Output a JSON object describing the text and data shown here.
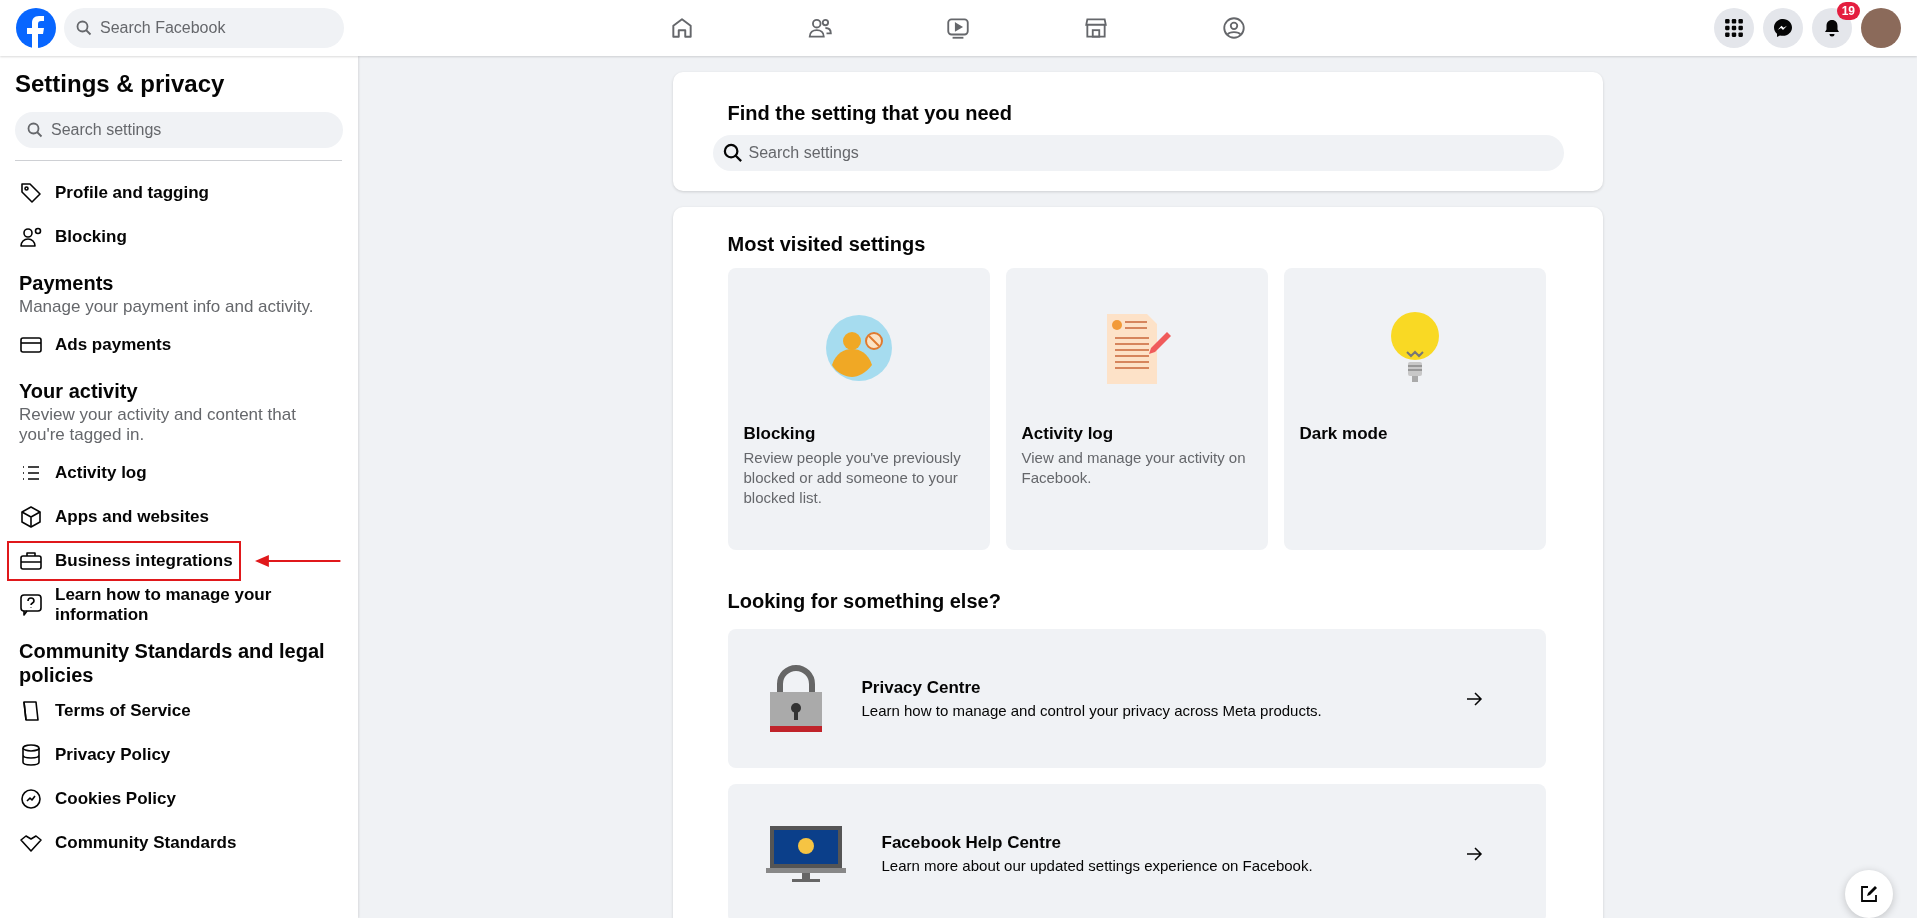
{
  "topbar": {
    "search": {
      "placeholder": "Search Facebook"
    },
    "notifications_badge": "19"
  },
  "sidebar": {
    "title": "Settings & privacy",
    "search": {
      "placeholder": "Search settings"
    },
    "sections": [
      {
        "items": [
          {
            "label": "Profile and tagging",
            "highlighted": false
          },
          {
            "label": "Blocking",
            "highlighted": false
          }
        ]
      },
      {
        "heading": "Payments",
        "description": "Manage your payment info and activity.",
        "items": [
          {
            "label": "Ads payments",
            "highlighted": false
          }
        ]
      },
      {
        "heading": "Your activity",
        "description": "Review your activity and content that you're tagged in.",
        "items": [
          {
            "label": "Activity log",
            "highlighted": false
          },
          {
            "label": "Apps and websites",
            "highlighted": false
          },
          {
            "label": "Business integrations",
            "highlighted": true
          },
          {
            "label": "Learn how to manage your information",
            "highlighted": false
          }
        ]
      },
      {
        "heading": "Community Standards and legal policies",
        "items": [
          {
            "label": "Terms of Service",
            "highlighted": false
          },
          {
            "label": "Privacy Policy",
            "highlighted": false
          },
          {
            "label": "Cookies Policy",
            "highlighted": false
          },
          {
            "label": "Community Standards",
            "highlighted": false
          }
        ]
      }
    ]
  },
  "find": {
    "title": "Find the setting that you need",
    "search": {
      "placeholder": "Search settings"
    }
  },
  "most_visited": {
    "title": "Most visited settings",
    "tiles": [
      {
        "title": "Blocking",
        "description": "Review people you've previously blocked or add someone to your blocked list."
      },
      {
        "title": "Activity log",
        "description": "View and manage your activity on Facebook."
      },
      {
        "title": "Dark mode"
      }
    ]
  },
  "looking": {
    "title": "Looking for something else?",
    "links": [
      {
        "title": "Privacy Centre",
        "description": "Learn how to manage and control your privacy across Meta products."
      },
      {
        "title": "Facebook Help Centre",
        "description": "Learn more about our updated settings experience on Facebook."
      }
    ]
  }
}
